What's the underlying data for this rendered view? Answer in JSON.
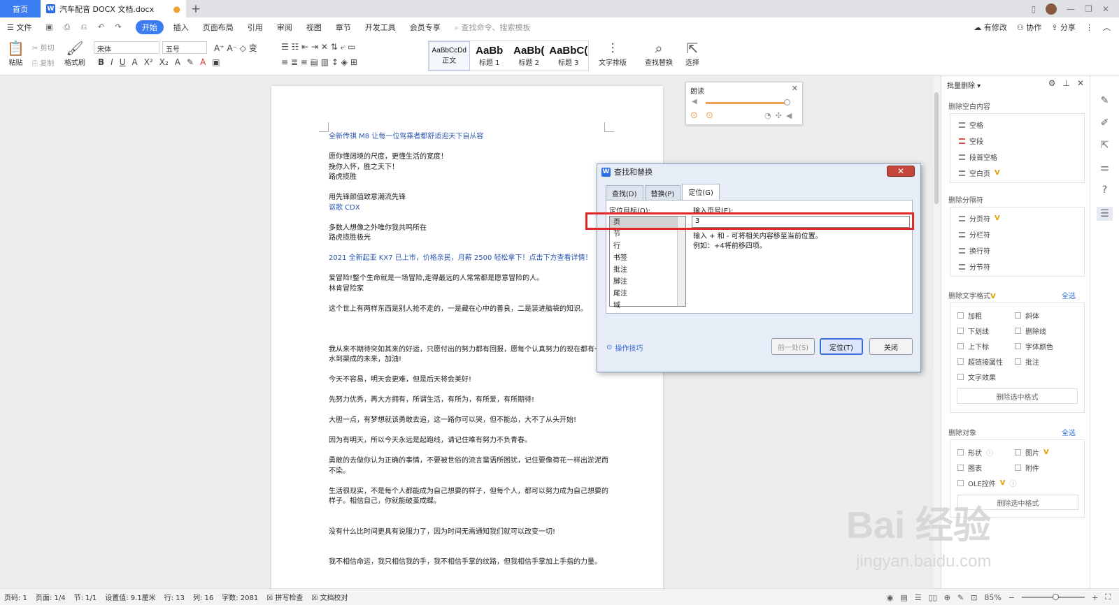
{
  "tabbar": {
    "home": "首页",
    "doc_tab": "汽车配音 DOCX 文档.docx",
    "new_tab": "+"
  },
  "menubar": {
    "items": [
      "文件",
      "开始",
      "插入",
      "页面布局",
      "引用",
      "审阅",
      "视图",
      "章节",
      "开发工具",
      "会员专享"
    ],
    "active": "开始",
    "search_placeholder": "查找命令、搜索模板",
    "right": [
      "有修改",
      "协作",
      "分享"
    ]
  },
  "ribbon": {
    "paste": "粘贴",
    "cut": "剪切",
    "copy": "复制",
    "format_brush": "格式刷",
    "font_name": "宋体",
    "font_size": "五号",
    "styles": [
      {
        "preview": "AaBbCcDd",
        "label": "正文"
      },
      {
        "preview": "AaBb",
        "label": "标题 1"
      },
      {
        "preview": "AaBb(",
        "label": "标题 2"
      },
      {
        "preview": "AaBbC(",
        "label": "标题 3"
      }
    ],
    "text_layout": "文字排版",
    "find_replace": "查找替换",
    "select": "选择"
  },
  "document": {
    "lines": [
      {
        "text": "全新传祺 M8 让每一位驾乘者都舒适迎天下自从容",
        "color": "blue"
      },
      {
        "text": ""
      },
      {
        "text": "愿你懂阔境的尺度，更懂生活的宽度！"
      },
      {
        "text": "挽你入怀，胜之天下！"
      },
      {
        "text": "路虎揽胜"
      },
      {
        "text": ""
      },
      {
        "text": "用先锋颜值致意潮流先锋"
      },
      {
        "text": "讴歌 CDX",
        "color": "blue"
      },
      {
        "text": ""
      },
      {
        "text": "多数人想像之外唯你我共鸣所在"
      },
      {
        "text": "路虎揽胜极光"
      },
      {
        "text": ""
      },
      {
        "text": "2021 全新起亚 KX7 已上市，价格亲民，月薪 2500 轻松拿下！点击下方查看详情！",
        "color": "blue"
      },
      {
        "text": ""
      },
      {
        "text": "爱冒险!整个生命就是一场冒险,走得最远的人常常都是愿意冒险的人。"
      },
      {
        "text": "林肯冒险家"
      },
      {
        "text": ""
      },
      {
        "text": "这个世上有两样东西是别人抢不走的，一是藏在心中的善良，二是装进脑袋的知识。"
      },
      {
        "text": ""
      },
      {
        "text": ""
      },
      {
        "text": ""
      },
      {
        "text": "我从来不期待突如其来的好运，只愿付出的努力都有回报，愿每个认真努力的现在都有一个"
      },
      {
        "text": "水到渠成的未来，加油!"
      },
      {
        "text": ""
      },
      {
        "text": "今天不容易，明天会更难，但是后天将会美好!"
      },
      {
        "text": ""
      },
      {
        "text": "先努力优秀，再大方拥有，所谓生活，有所为，有所爱，有所期待!"
      },
      {
        "text": ""
      },
      {
        "text": "大胆一点，有梦想就该勇敢去追，这一路你可以哭，但不能怂，大不了从头开始!"
      },
      {
        "text": ""
      },
      {
        "text": "因为有明天，所以今天永远是起跑线，请记住唯有努力不负青春。"
      },
      {
        "text": ""
      },
      {
        "text": "勇敢的去做你认为正确的事情，不要被世俗的流言蜚语所困扰，记住要像荷花一样出淤泥而"
      },
      {
        "text": "不染。"
      },
      {
        "text": ""
      },
      {
        "text": "生活很现实，不是每个人都能成为自己想要的样子，但每个人，都可以努力成为自己想要的"
      },
      {
        "text": "样子。相信自己，你就能破茧成蝶。"
      },
      {
        "text": ""
      },
      {
        "text": ""
      },
      {
        "text": "没有什么比时间更具有说服力了，因为时间无需通知我们就可以改变一切!"
      },
      {
        "text": ""
      },
      {
        "text": ""
      },
      {
        "text": "我不相信命运，我只相信我的手，我不相信手掌的纹路，但我相信手掌加上手指的力量。"
      }
    ]
  },
  "read_aloud": {
    "title": "朗读"
  },
  "dialog": {
    "title": "查找和替换",
    "tabs": [
      "查找(D)",
      "替换(P)",
      "定位(G)"
    ],
    "active_tab": "定位(G)",
    "target_label": "定位目标(O):",
    "targets": [
      "页",
      "节",
      "行",
      "书签",
      "批注",
      "脚注",
      "尾注",
      "域"
    ],
    "selected_target": "页",
    "input_label": "输入页号(E):",
    "input_value": "3",
    "hint1": "输入 + 和 - 可将相关内容移至当前位置。",
    "hint2": "例如：+4将前移四项。",
    "tips": "操作技巧",
    "btn_prev": "前一处(S)",
    "btn_goto": "定位(T)",
    "btn_close": "关闭"
  },
  "right_panel": {
    "header": "批量删除",
    "sec_blank": "删除空白内容",
    "blank_items": [
      {
        "label": "空格",
        "vip": false
      },
      {
        "label": "空段",
        "vip": false
      },
      {
        "label": "段首空格",
        "vip": false
      },
      {
        "label": "空白页",
        "vip": true
      }
    ],
    "sec_break": "删除分隔符",
    "break_items": [
      {
        "label": "分页符",
        "vip": true
      },
      {
        "label": "分栏符",
        "vip": false
      },
      {
        "label": "换行符",
        "vip": false
      },
      {
        "label": "分节符",
        "vip": false
      }
    ],
    "sec_format": "删除文字格式",
    "select_all": "全选",
    "format_items": [
      "加粗",
      "斜体",
      "下划线",
      "删除线",
      "上下标",
      "字体颜色",
      "超链接属性",
      "批注",
      "文字效果"
    ],
    "btn_del_format": "删除选中格式",
    "sec_object": "删除对象",
    "object_items": [
      "形状",
      "图片",
      "图表",
      "附件",
      "OLE控件"
    ],
    "btn_del_object": "删除选中格式",
    "vip_mark": "V"
  },
  "statusbar": {
    "items": [
      "页码: 1",
      "页面: 1/4",
      "节: 1/1",
      "设置值: 9.1厘米",
      "行: 13",
      "列: 16",
      "字数: 2081",
      "拼写检查",
      "文档校对"
    ],
    "zoom": "85%"
  },
  "watermark": {
    "main": "Bai 经验",
    "sub": "jingyan.baidu.com"
  }
}
